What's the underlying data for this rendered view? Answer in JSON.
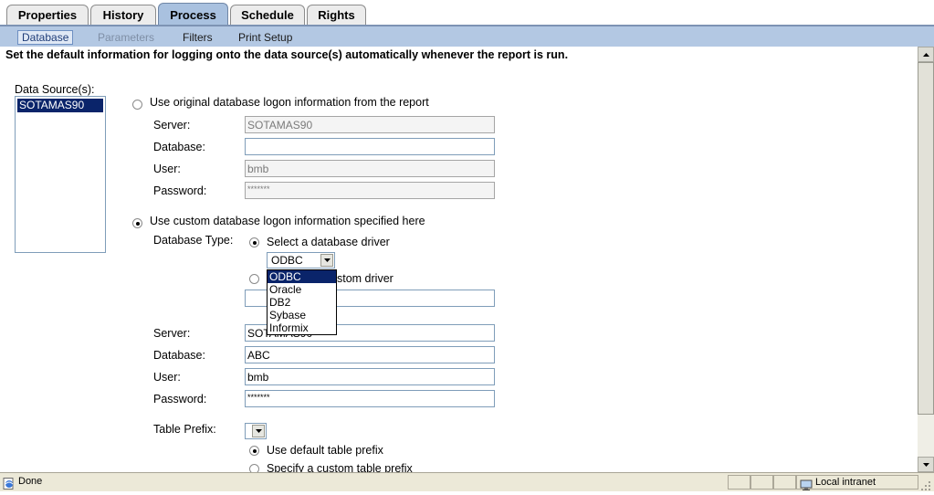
{
  "tabs": [
    "Properties",
    "History",
    "Process",
    "Schedule",
    "Rights"
  ],
  "subtabs": [
    "Database",
    "Parameters",
    "Filters",
    "Print Setup"
  ],
  "instruction": "Set the default information for logging onto the data source(s) automatically whenever the report is run.",
  "data_sources": {
    "label": "Data Source(s):",
    "items": [
      "SOTAMAS90"
    ]
  },
  "original": {
    "radio_label": "Use original database logon information from the report",
    "server_label": "Server:",
    "server_value": "SOTAMAS90",
    "database_label": "Database:",
    "database_value": "",
    "user_label": "User:",
    "user_value": "bmb",
    "password_label": "Password:",
    "password_value": "*******"
  },
  "custom": {
    "radio_label": "Use custom database logon information specified here",
    "db_type_label": "Database Type:",
    "select_driver_label": "Select a database driver",
    "driver_selected": "ODBC",
    "driver_options": [
      "ODBC",
      "Oracle",
      "DB2",
      "Sybase",
      "Informix"
    ],
    "custom_driver_label": "stom driver",
    "server_label": "Server:",
    "server_value": "SOTAMAS90",
    "database_label": "Database:",
    "database_value": "ABC",
    "user_label": "User:",
    "user_value": "bmb",
    "password_label": "Password:",
    "password_value": "*******",
    "table_prefix_label": "Table Prefix:",
    "default_prefix_label": "Use default table prefix",
    "custom_prefix_label": "Specify a custom table prefix"
  },
  "status": {
    "text": "Done",
    "zone": "Local intranet"
  },
  "icons": [
    "ie-page-icon",
    "intranet-zone-icon",
    "dropdown-arrow-icon",
    "scroll-up-icon",
    "scroll-down-icon"
  ]
}
